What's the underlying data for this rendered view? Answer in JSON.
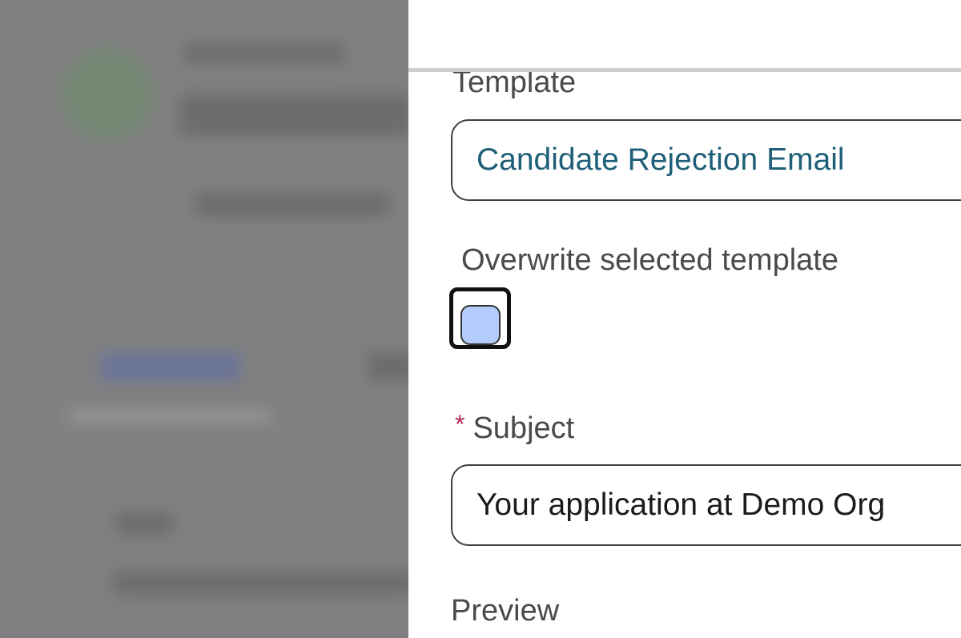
{
  "form": {
    "template_label": "Template",
    "template_value": "Candidate Rejection Email",
    "overwrite_label": "Overwrite selected template",
    "overwrite_checked": false,
    "subject_required_marker": "*",
    "subject_label": "Subject",
    "subject_value": "Your application at Demo Org",
    "preview_label": "Preview"
  },
  "colors": {
    "template_text": "#1f5f78",
    "checkbox_fill": "#b3ccfb",
    "required_marker": "#b3265a",
    "overlay": "#808080"
  }
}
